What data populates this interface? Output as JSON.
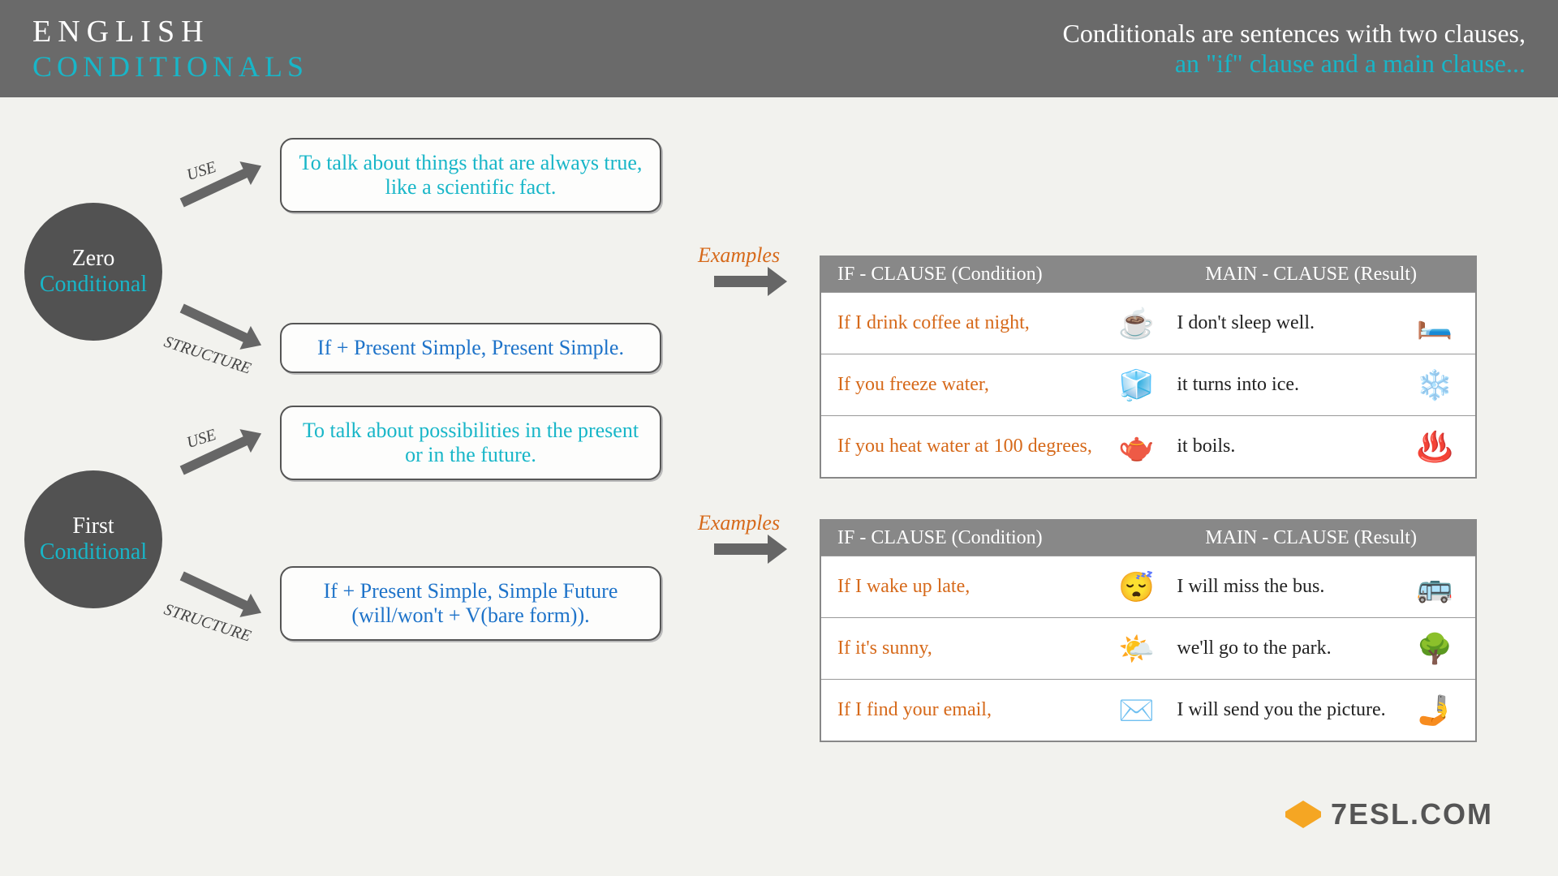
{
  "header": {
    "left_line1": "ENGLISH",
    "left_line2": "CONDITIONALS",
    "right_line1": "Conditionals are sentences with two clauses,",
    "right_line2": "an \"if\" clause and a main clause..."
  },
  "zero": {
    "circle_name": "Zero",
    "circle_cond": "Conditional",
    "use_tag": "USE",
    "structure_tag": "STRUCTURE",
    "use_text": "To talk about things that are always true, like a scientific fact.",
    "structure_text": "If + Present Simple, Present Simple.",
    "examples_label": "Examples",
    "table_header_col1": "IF - CLAUSE (Condition)",
    "table_header_col2": "MAIN - CLAUSE (Result)",
    "rows": [
      {
        "if": "If I drink coffee at night,",
        "icon1": "☕",
        "main": "I don't sleep well.",
        "icon2": "🛏️"
      },
      {
        "if": "If you freeze water,",
        "icon1": "🧊",
        "main": "it turns into ice.",
        "icon2": "❄️"
      },
      {
        "if": "If you heat water at 100 degrees,",
        "icon1": "🫖",
        "main": "it boils.",
        "icon2": "♨️"
      }
    ]
  },
  "first": {
    "circle_name": "First",
    "circle_cond": "Conditional",
    "use_tag": "USE",
    "structure_tag": "STRUCTURE",
    "use_text": "To talk about possibilities in the present or in the future.",
    "structure_text": "If + Present Simple, Simple Future (will/won't + V(bare form)).",
    "examples_label": "Examples",
    "table_header_col1": "IF - CLAUSE (Condition)",
    "table_header_col2": "MAIN - CLAUSE (Result)",
    "rows": [
      {
        "if": "If I wake up late,",
        "icon1": "😴",
        "main": "I will miss the bus.",
        "icon2": "🚌"
      },
      {
        "if": "If it's sunny,",
        "icon1": "🌤️",
        "main": "we'll go to the park.",
        "icon2": "🌳"
      },
      {
        "if": "If I find your email,",
        "icon1": "✉️",
        "main": "I will send you the picture.",
        "icon2": "🤳"
      }
    ]
  },
  "footer": {
    "brand": "7ESL.COM"
  }
}
